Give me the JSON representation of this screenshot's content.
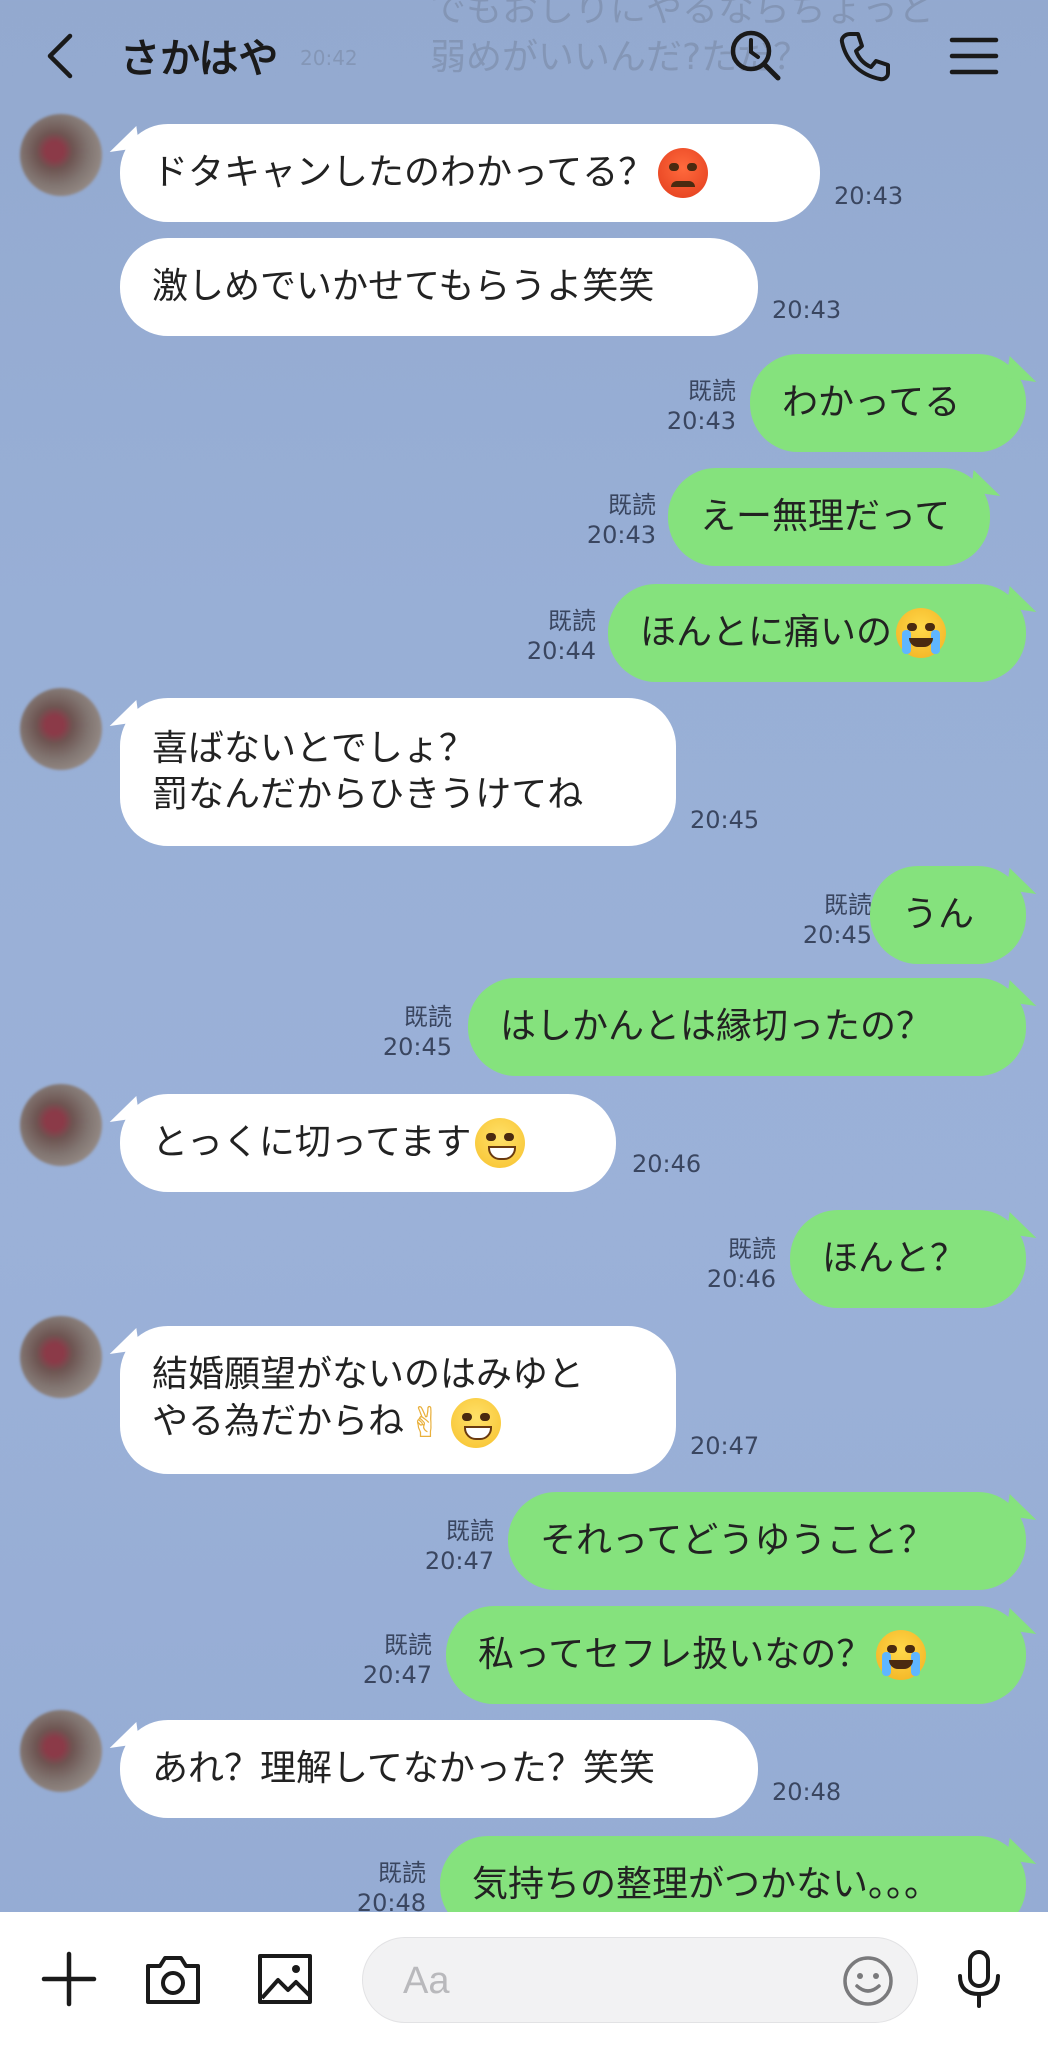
{
  "header": {
    "title": "さかはや",
    "ghost_line1": "でもおしりにやるならちょっと",
    "ghost_line2": "弱めがいいんだ?ただ？",
    "ghost_time": "20:42"
  },
  "messages": [
    {
      "dir": "in",
      "text": "ドタキャンしたのわかってる？",
      "emoji": "angry-face",
      "time": "20:43"
    },
    {
      "dir": "in",
      "text": "激しめでいかせてもらうよ笑笑",
      "time": "20:43"
    },
    {
      "dir": "out",
      "text": "わかってる",
      "read": "既読",
      "time": "20:43"
    },
    {
      "dir": "out",
      "text": "えー無理だって",
      "read": "既読",
      "time": "20:43"
    },
    {
      "dir": "out",
      "text": "ほんとに痛いの",
      "emoji": "crying-face",
      "read": "既読",
      "time": "20:44"
    },
    {
      "dir": "in",
      "line1": "喜ばないとでしょ？",
      "line2": "罰なんだからひきうけてね",
      "time": "20:45"
    },
    {
      "dir": "out",
      "text": "うん",
      "read": "既読",
      "time": "20:45"
    },
    {
      "dir": "out",
      "text": "はしかんとは縁切ったの？",
      "read": "既読",
      "time": "20:45"
    },
    {
      "dir": "in",
      "text": "とっくに切ってます",
      "emoji": "grinning-face",
      "time": "20:46"
    },
    {
      "dir": "out",
      "text": "ほんと？",
      "read": "既読",
      "time": "20:46"
    },
    {
      "dir": "in",
      "line1": "結婚願望がないのはみゆと",
      "line2": "やる為だからね",
      "emoji": "victory-hand, grinning-face",
      "time": "20:47"
    },
    {
      "dir": "out",
      "text": "それってどうゆうこと？",
      "read": "既読",
      "time": "20:47"
    },
    {
      "dir": "out",
      "text": "私ってセフレ扱いなの？",
      "emoji": "crying-face",
      "read": "既読",
      "time": "20:47"
    },
    {
      "dir": "in",
      "text": "あれ？理解してなかった？笑笑",
      "time": "20:48"
    },
    {
      "dir": "out",
      "text": "気持ちの整理がつかない。。。",
      "read": "既読",
      "time": "20:48"
    }
  ],
  "input": {
    "placeholder": "Aa"
  },
  "colors": {
    "incoming": "#ffffff",
    "outgoing": "#85e27d",
    "background": "#96acd4"
  }
}
